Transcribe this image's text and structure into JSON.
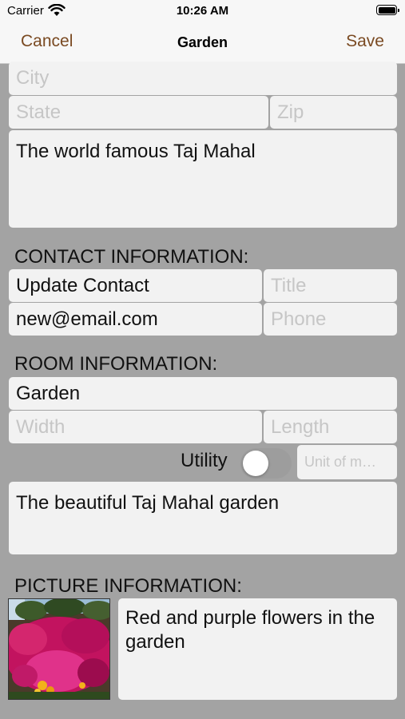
{
  "status_bar": {
    "carrier": "Carrier",
    "time": "10:26 AM"
  },
  "nav": {
    "cancel": "Cancel",
    "title": "Garden",
    "save": "Save"
  },
  "address": {
    "city_placeholder": "City",
    "state_placeholder": "State",
    "zip_placeholder": "Zip",
    "description": "The world famous Taj Mahal"
  },
  "contact": {
    "header": "CONTACT INFORMATION:",
    "name": "Update Contact",
    "title_placeholder": "Title",
    "email": "new@email.com",
    "phone_placeholder": "Phone"
  },
  "room": {
    "header": "ROOM INFORMATION:",
    "name": "Garden",
    "width_placeholder": "Width",
    "length_placeholder": "Length",
    "utility_label": "Utility",
    "utility_on": false,
    "unit_placeholder": "Unit of m…",
    "description": "The beautiful Taj Mahal garden"
  },
  "picture": {
    "header": "PICTURE INFORMATION:",
    "image_icon": "flower-photo",
    "caption": "Red and purple flowers in the garden"
  }
}
